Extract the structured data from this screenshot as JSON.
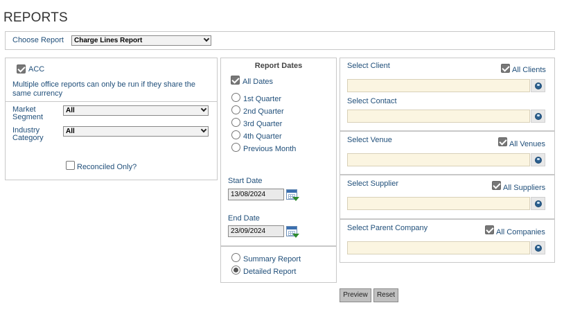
{
  "page": {
    "title": "REPORTS"
  },
  "choose_report": {
    "label": "Choose Report",
    "selected": "Charge Lines Report"
  },
  "left": {
    "acc_label": "ACC",
    "acc_checked": true,
    "notice": "Multiple office reports can only be run if they share the same currency",
    "market_segment": {
      "label_1": "Market",
      "label_2": "Segment",
      "selected": "All"
    },
    "industry_category": {
      "label_1": "Industry",
      "label_2": "Category",
      "selected": "All"
    },
    "reconciled_label": "Reconciled Only?",
    "reconciled_checked": false
  },
  "dates": {
    "heading": "Report Dates",
    "all_dates_label": "All Dates",
    "all_dates_checked": true,
    "options": [
      "1st Quarter",
      "2nd Quarter",
      "3rd Quarter",
      "4th Quarter",
      "Previous Month"
    ],
    "start_label": "Start Date",
    "start_value": "13/08/2024",
    "end_label": "End Date",
    "end_value": "23/09/2024",
    "report_types": [
      "Summary Report",
      "Detailed Report"
    ],
    "selected_report_type": "Detailed Report"
  },
  "right": {
    "client": {
      "label": "Select Client",
      "all_label": "All Clients",
      "all_checked": true
    },
    "contact": {
      "label": "Select Contact"
    },
    "venue": {
      "label": "Select Venue",
      "all_label": "All Venues",
      "all_checked": true
    },
    "supplier": {
      "label": "Select Supplier",
      "all_label": "All Suppliers",
      "all_checked": true
    },
    "parent_company": {
      "label": "Select Parent Company",
      "all_label": "All Companies",
      "all_checked": true
    }
  },
  "buttons": {
    "preview": "Preview",
    "reset": "Reset"
  },
  "icons": {
    "calendar": "calendar-icon",
    "lookup": "globe-icon"
  },
  "colors": {
    "label_blue": "#1f4e79",
    "lookup_bg": "#fbf5e1",
    "button_grey": "#c0c0c0"
  }
}
